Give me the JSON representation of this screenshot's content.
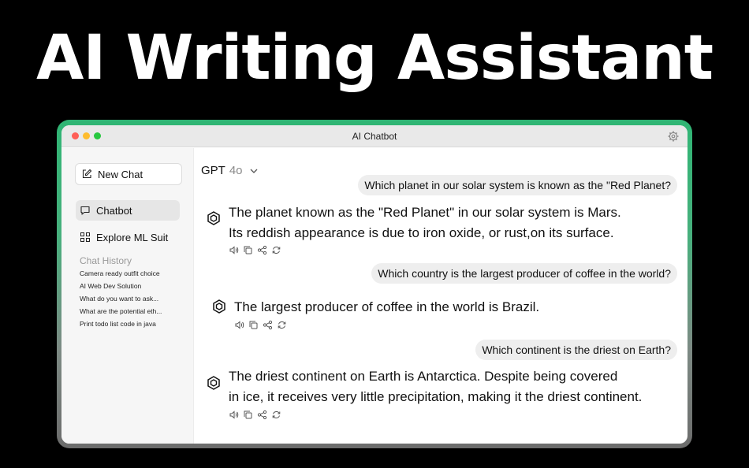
{
  "headline": "AI Writing Assistant",
  "window": {
    "title": "AI Chatbot"
  },
  "sidebar": {
    "new_chat_label": "New Chat",
    "nav": [
      {
        "label": "Chatbot",
        "icon": "chat-bubble-icon",
        "active": true
      },
      {
        "label": "Explore ML Suit",
        "icon": "grid-icon",
        "active": false
      }
    ],
    "history_title": "Chat History",
    "history": [
      "Camera ready outfit choice",
      "AI Web Dev Solution",
      "What do you want to ask...",
      "What are the potential eth...",
      "Print todo list code in java"
    ]
  },
  "model": {
    "name": "GPT",
    "version": "4o"
  },
  "messages": [
    {
      "role": "user",
      "text": "Which planet in our solar system is known as the \"Red Planet?"
    },
    {
      "role": "assistant",
      "lines": [
        "The planet known as the \"Red Planet\" in our solar system is Mars.",
        "Its reddish appearance is due to iron oxide, or rust,on its surface."
      ]
    },
    {
      "role": "user",
      "text": "Which country is the largest producer of coffee in the world?"
    },
    {
      "role": "assistant",
      "lines": [
        "The largest producer of coffee in the world is Brazil."
      ]
    },
    {
      "role": "user",
      "text": "Which continent is the driest on Earth?"
    },
    {
      "role": "assistant",
      "lines": [
        "The driest continent on Earth is Antarctica. Despite being covered",
        "in ice, it receives very little precipitation, making it the driest continent."
      ]
    }
  ],
  "message_actions": [
    "speaker-icon",
    "copy-icon",
    "share-icon",
    "regenerate-icon"
  ],
  "colors": {
    "frame_accent": "#2fb574",
    "background": "#000000"
  }
}
